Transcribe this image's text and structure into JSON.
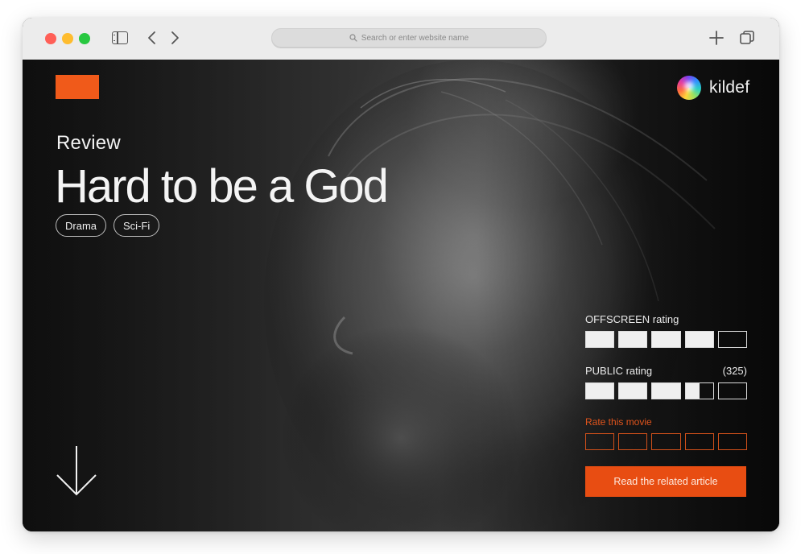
{
  "browser": {
    "search_placeholder": "Search or enter website name"
  },
  "site": {
    "logo_text": "kildef",
    "accent_color": "#f05a1a"
  },
  "hero": {
    "label": "Review",
    "title": "Hard to be a God",
    "tags": [
      "Drama",
      "Sci-Fi"
    ]
  },
  "ratings": {
    "offscreen": {
      "label": "OFFSCREEN rating",
      "value": 4,
      "max": 5
    },
    "public": {
      "label": "PUBLIC rating",
      "count": "(325)",
      "value": 3.5,
      "max": 5
    },
    "rate": {
      "label": "Rate this movie",
      "value": 0,
      "max": 5
    }
  },
  "cta": {
    "label": "Read the related article"
  },
  "icons": {
    "down": "arrow-down-icon",
    "search": "search-icon"
  }
}
